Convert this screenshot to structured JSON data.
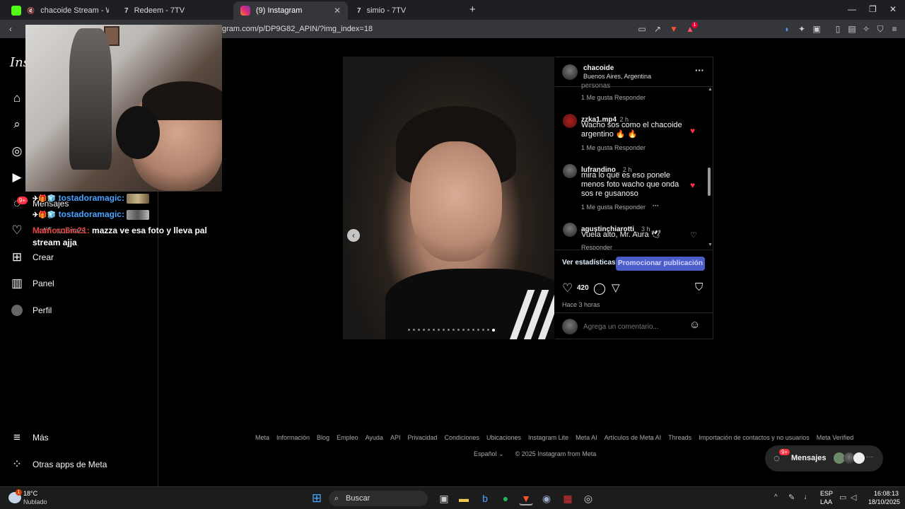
{
  "browser": {
    "tabs": [
      {
        "label": "chacoide Stream - Watch Live on",
        "favicon_color": "#53fc18"
      },
      {
        "label": "Redeem - 7TV",
        "favicon_color": "#ffffff"
      },
      {
        "label": "(9) Instagram",
        "favicon_color": "#e1306c"
      },
      {
        "label": "simio - 7TV",
        "favicon_color": "#ffffff"
      }
    ],
    "new_tab": "+",
    "url": "gram.com/p/DP9G82_APIN/?img_index=18",
    "notif_badge": "1"
  },
  "sidebar": {
    "logo": "Ins",
    "items": [
      {
        "label": "",
        "icon": "home-icon"
      },
      {
        "label": "",
        "icon": "search-icon"
      },
      {
        "label": "",
        "icon": "explore-icon"
      },
      {
        "label": "",
        "icon": "reels-icon"
      },
      {
        "label": "Mensajes",
        "icon": "messenger-icon",
        "badge": "9+"
      },
      {
        "label": "Notificaciones",
        "icon": "heart-icon"
      },
      {
        "label": "Crear",
        "icon": "plus-icon"
      },
      {
        "label": "Panel",
        "icon": "chart-icon"
      },
      {
        "label": "Perfil",
        "icon": "avatar"
      }
    ],
    "more": "Más",
    "meta_apps": "Otras apps de Meta"
  },
  "chat": [
    {
      "user": "tostadoramagic:"
    },
    {
      "user": "tostadoramagic:"
    },
    {
      "user": "Mamoru6ic21:",
      "message": "mazza ve esa foto y lleva pal stream ajja"
    }
  ],
  "post": {
    "username": "chacoide",
    "location": "Buenos Aires, Argentina",
    "more": "···",
    "truncated_text": "personas",
    "comments": [
      {
        "meta_likes": "1 Me gusta",
        "reply": "Responder"
      },
      {
        "user": "zzka1.mp4",
        "time": "2 h",
        "text": "Wacho sos como el chacoide argentino 🔥 🔥",
        "likes": "1 Me gusta",
        "reply": "Responder",
        "liked": true
      },
      {
        "user": "lufrandino_",
        "time": "2 h",
        "text": "mira lo que es eso ponele menos foto wacho que onda sos re gusanoso",
        "likes": "1 Me gusta",
        "reply": "Responder",
        "dots": "···",
        "liked": true
      },
      {
        "user": "agustinchiarotti_",
        "time": "3 h",
        "text": "Vuela alto, Mr. Aura 🕊",
        "reply": "Responder",
        "liked": false
      }
    ],
    "stats_link": "Ver estadísticas",
    "promote": "Promocionar publicación",
    "like_count": "420",
    "posted": "Hace 3 horas",
    "comment_placeholder": "Agrega un comentario...",
    "carousel_index": 18
  },
  "footer": {
    "links": [
      "Meta",
      "Información",
      "Blog",
      "Empleo",
      "Ayuda",
      "API",
      "Privacidad",
      "Condiciones",
      "Ubicaciones",
      "Instagram Lite",
      "Meta AI",
      "Artículos de Meta AI",
      "Threads",
      "Importación de contactos y no usuarios",
      "Meta Verified"
    ],
    "language": "Español",
    "copyright": "© 2025 Instagram from Meta"
  },
  "messages_pill": {
    "label": "Mensajes",
    "badge": "9+",
    "dots": "···"
  },
  "taskbar": {
    "weather_temp": "18°C",
    "weather_desc": "Nublado",
    "weather_badge": "1",
    "search": "Buscar",
    "lang": "ESP",
    "layout": "LAA",
    "time": "16:08:13",
    "date": "18/10/2025"
  }
}
